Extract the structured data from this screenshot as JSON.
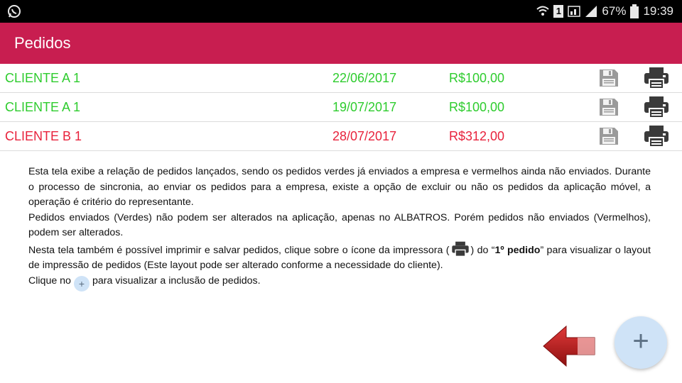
{
  "status_bar": {
    "battery": "67%",
    "time": "19:39",
    "sim": "1"
  },
  "app_bar": {
    "title": "Pedidos"
  },
  "orders": [
    {
      "client": "CLIENTE A 1",
      "date": "22/06/2017",
      "value": "R$100,00",
      "color": "#2ecc2e"
    },
    {
      "client": "CLIENTE A 1",
      "date": "19/07/2017",
      "value": "R$100,00",
      "color": "#2ecc2e"
    },
    {
      "client": "CLIENTE B 1",
      "date": "28/07/2017",
      "value": "R$312,00",
      "color": "#e8223c"
    }
  ],
  "description": {
    "p1": "Esta tela exibe a relação de pedidos lançados, sendo os pedidos verdes já enviados a empresa e vermelhos ainda não enviados. Durante o processo de sincronia, ao enviar os pedidos para a empresa, existe a opção de excluir ou não os pedidos da aplicação móvel, a operação é critério do representante.",
    "p2": "Pedidos enviados (Verdes) não podem ser alterados na aplicação, apenas no ALBATROS. Porém pedidos não enviados (Vermelhos), podem ser alterados.",
    "p3_a": "Nesta tela também é possível imprimir e salvar pedidos, clique sobre o ícone da impressora (",
    "p3_b": ") do “",
    "p3_bold": "1º pedido",
    "p3_c": "” para visualizar o layout de impressão de pedidos (Este layout pode ser alterado conforme a necessidade do cliente).",
    "p4_a": "Clique no",
    "p4_plus": "+",
    "p4_b": "para visualizar a inclusão de pedidos."
  },
  "fab": {
    "label": "+"
  },
  "icons": {
    "save": "floppy-disk-icon",
    "print": "printer-icon",
    "arrow": "red-arrow-left-icon"
  }
}
